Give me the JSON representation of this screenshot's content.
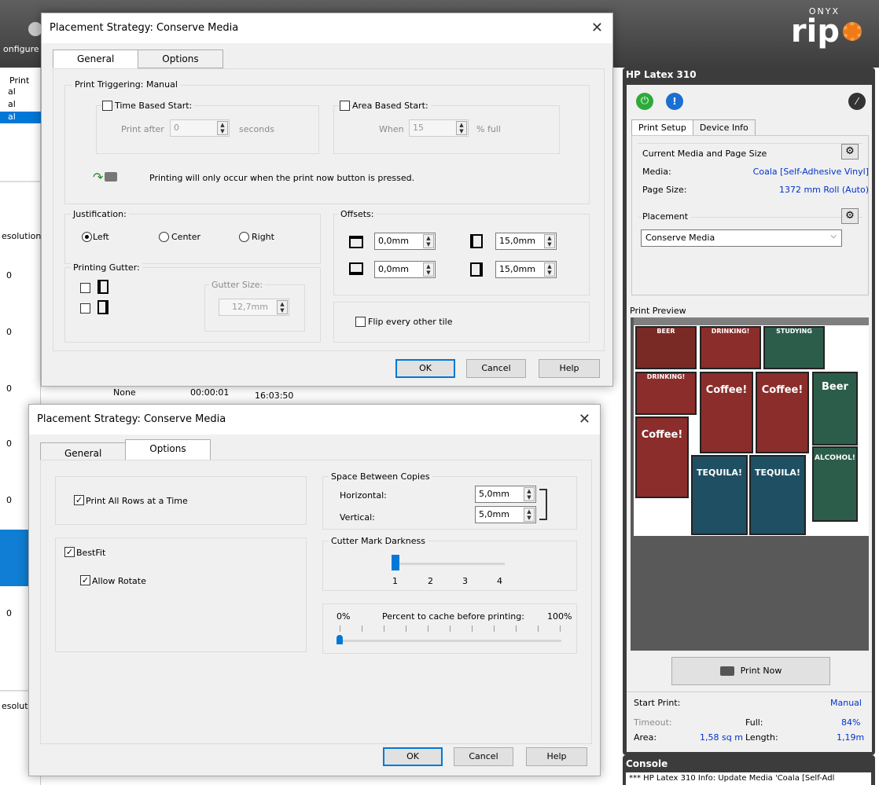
{
  "app": {
    "logo_brand": "ONYX",
    "logo_product": "rip",
    "left_configure": "onfigure",
    "left_items": [
      "Print",
      "al",
      "al",
      "al"
    ],
    "left_resolution_label": "esolution",
    "left_resolution_label2": "esolut",
    "left_zero": "0",
    "job_row": {
      "col1": "None",
      "col2": "00:00:01",
      "col3": "16:03:50"
    }
  },
  "printer_panel": {
    "title": "HP Latex 310",
    "tabs": [
      "Print Setup",
      "Device Info"
    ],
    "media_group_title": "Current Media and Page Size",
    "media_label": "Media:",
    "media_value": "Coala [Self-Adhesive Vinyl]",
    "page_size_label": "Page Size:",
    "page_size_value": "1372 mm Roll (Auto)",
    "placement_title": "Placement",
    "placement_value": "Conserve Media",
    "preview_label": "Print Preview",
    "print_now": "Print Now",
    "start_print_label": "Start Print:",
    "start_print_value": "Manual",
    "timeout_label": "Timeout:",
    "full_label": "Full:",
    "full_value": "84%",
    "area_label": "Area:",
    "area_value": "1,58 sq m",
    "length_label": "Length:",
    "length_value": "1,19m",
    "console_title": "Console",
    "console_text": "*** HP Latex 310 Info: Update Media 'Coala [Self-Adl"
  },
  "posters": [
    "BEER",
    "DRINKING!",
    "STUDYING",
    "DRINKING!",
    "Coffee!",
    "Coffee!",
    "Beer",
    "Coffee!",
    "TEQUILA!",
    "TEQUILA!",
    "ALCOHOL!"
  ],
  "dialog1": {
    "title": "Placement Strategy: Conserve Media",
    "tabs": [
      "General",
      "Options"
    ],
    "triggering_title": "Print Triggering: Manual",
    "time_based": "Time Based Start:",
    "print_after": "Print after",
    "print_after_value": "0",
    "seconds": "seconds",
    "area_based": "Area Based Start:",
    "when": "When",
    "when_value": "15",
    "pct_full": "% full",
    "info_text": "Printing will only occur when the print now button is pressed.",
    "justification_title": "Justification:",
    "just_left": "Left",
    "just_center": "Center",
    "just_right": "Right",
    "offsets_title": "Offsets:",
    "offset_top": "0,0mm",
    "offset_left": "15,0mm",
    "offset_bottom": "0,0mm",
    "offset_right": "15,0mm",
    "gutter_title": "Printing Gutter:",
    "gutter_size_title": "Gutter Size:",
    "gutter_size_value": "12,7mm",
    "flip_label": "Flip every other tile",
    "ok": "OK",
    "cancel": "Cancel",
    "help": "Help"
  },
  "dialog2": {
    "title": "Placement Strategy: Conserve Media",
    "tabs": [
      "General",
      "Options"
    ],
    "print_all_rows": "Print All Rows at a Time",
    "bestfit": "BestFit",
    "allow_rotate": "Allow Rotate",
    "space_title": "Space Between Copies",
    "horizontal_label": "Horizontal:",
    "horizontal_value": "5,0mm",
    "vertical_label": "Vertical:",
    "vertical_value": "5,0mm",
    "cutter_title": "Cutter Mark Darkness",
    "cutter_ticks": [
      "1",
      "2",
      "3",
      "4"
    ],
    "cutter_value": 1,
    "cache_min": "0%",
    "cache_label": "Percent to cache before printing:",
    "cache_max": "100%",
    "cache_value": 0,
    "ok": "OK",
    "cancel": "Cancel",
    "help": "Help"
  }
}
